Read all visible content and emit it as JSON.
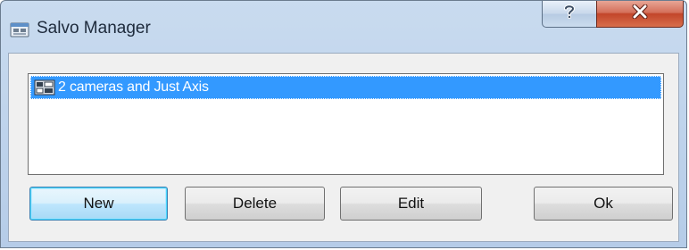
{
  "window": {
    "title": "Salvo Manager",
    "icons": {
      "app": "salvo-manager-icon",
      "help": "question-mark-icon",
      "close": "close-x-icon"
    },
    "colors": {
      "selection": "#3399ff",
      "close_button": "#c2452a",
      "frame": "#b5cce8"
    }
  },
  "list": {
    "items": [
      {
        "label": "2 cameras and Just Axis",
        "icon": "camera-group-icon",
        "selected": true
      }
    ]
  },
  "buttons": {
    "new": "New",
    "delete": "Delete",
    "edit": "Edit",
    "ok": "Ok"
  }
}
